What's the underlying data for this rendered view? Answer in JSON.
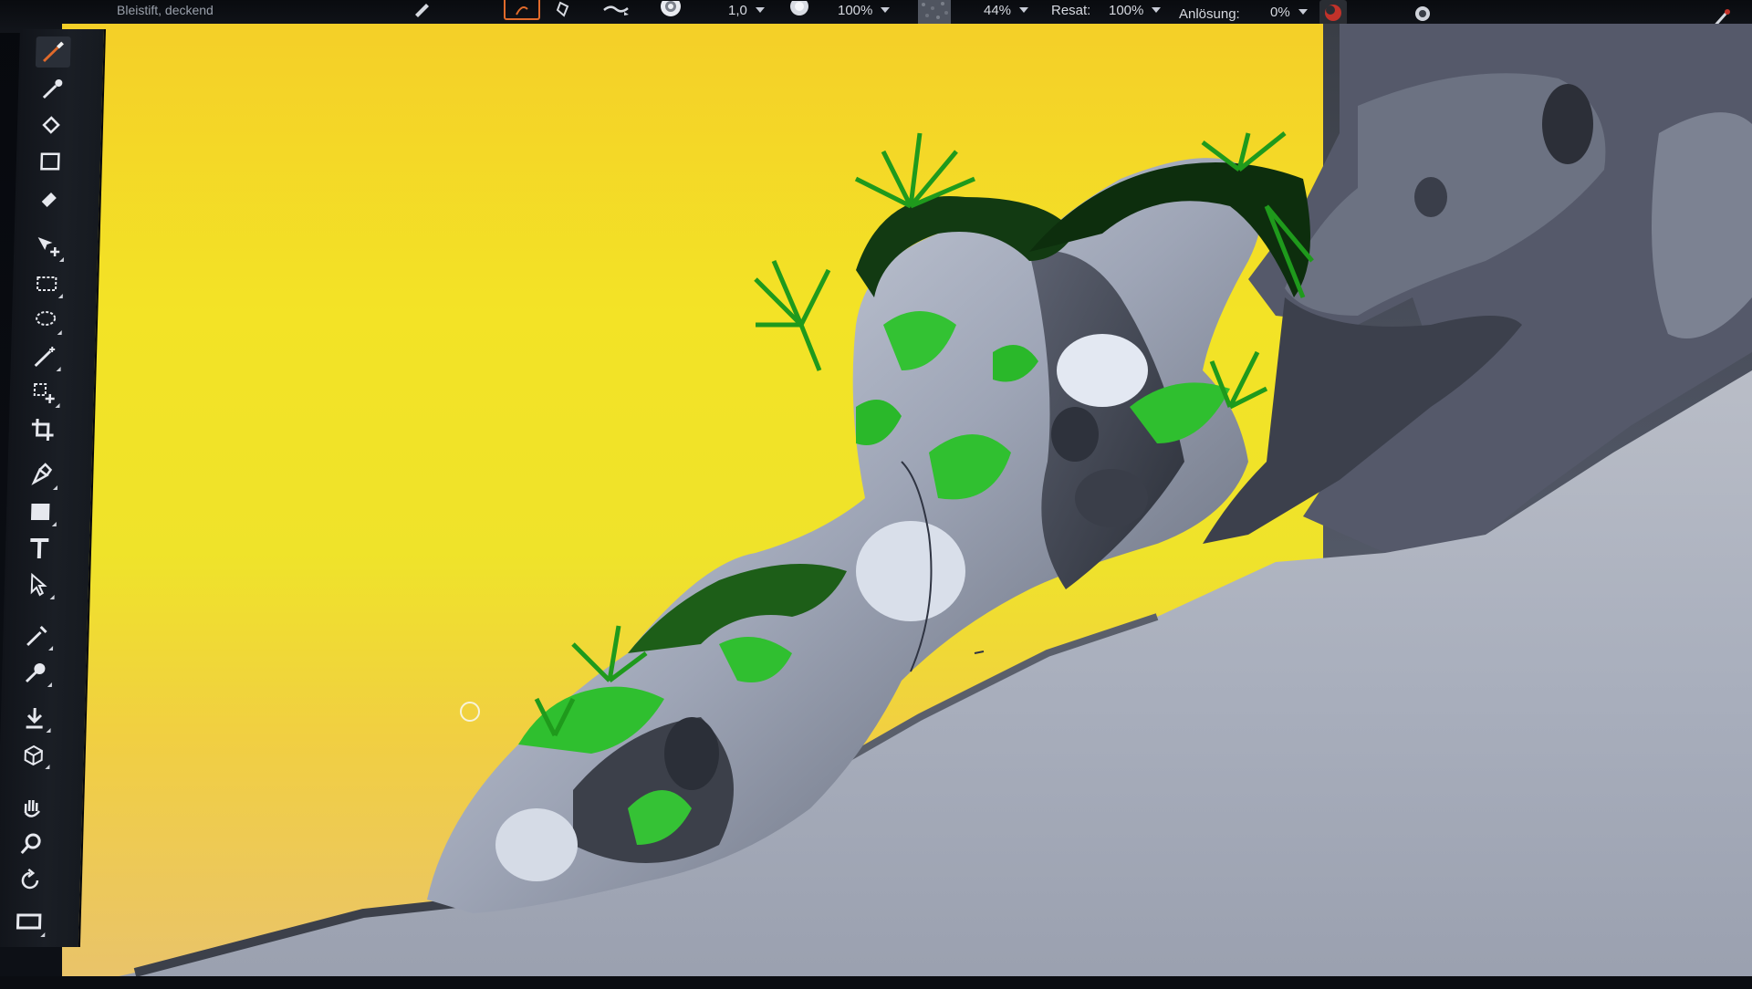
{
  "toolbar": {
    "preset_name": "Bleistift, deckend",
    "size_value": "1,0",
    "opacity_value": "100%",
    "flow_value": "44%",
    "resat_label": "Resat:",
    "resat_value": "100%",
    "bleed_label": "Anlösung:",
    "bleed_value": "0%"
  },
  "tools": [
    {
      "name": "brush-tool-icon",
      "active": true
    },
    {
      "name": "dropper-tool-icon",
      "active": false
    },
    {
      "name": "paint-bucket-tool-icon",
      "active": false
    },
    {
      "name": "paper-color-tool-icon",
      "active": false
    },
    {
      "name": "eraser-tool-icon",
      "active": false
    },
    {
      "name": "move-tool-icon",
      "active": false
    },
    {
      "name": "rectangle-selection-tool-icon",
      "active": false
    },
    {
      "name": "lasso-tool-icon",
      "active": false
    },
    {
      "name": "magic-wand-tool-icon",
      "active": false
    },
    {
      "name": "transform-tool-icon",
      "active": false
    },
    {
      "name": "crop-tool-icon",
      "active": false
    },
    {
      "name": "pen-tool-icon",
      "active": false
    },
    {
      "name": "shape-tool-icon",
      "active": false
    },
    {
      "name": "text-tool-icon",
      "active": false
    },
    {
      "name": "selection-arrow-tool-icon",
      "active": false
    },
    {
      "name": "cloner-tool-icon",
      "active": false
    },
    {
      "name": "blend-tool-icon",
      "active": false
    },
    {
      "name": "fill-tool-icon",
      "active": false
    },
    {
      "name": "mirror-tool-icon",
      "active": false
    },
    {
      "name": "hand-tool-icon",
      "active": false
    },
    {
      "name": "zoom-tool-icon",
      "active": false
    },
    {
      "name": "rotate-tool-icon",
      "active": false
    },
    {
      "name": "screen-mode-icon",
      "active": false
    }
  ],
  "colors": {
    "accent": "#e06a2b",
    "canvas_yellow": "#f3e326",
    "rock_gray": "#b9bfcc",
    "moss_green": "#2fbf2f",
    "ground_gray": "#9da4b3"
  }
}
